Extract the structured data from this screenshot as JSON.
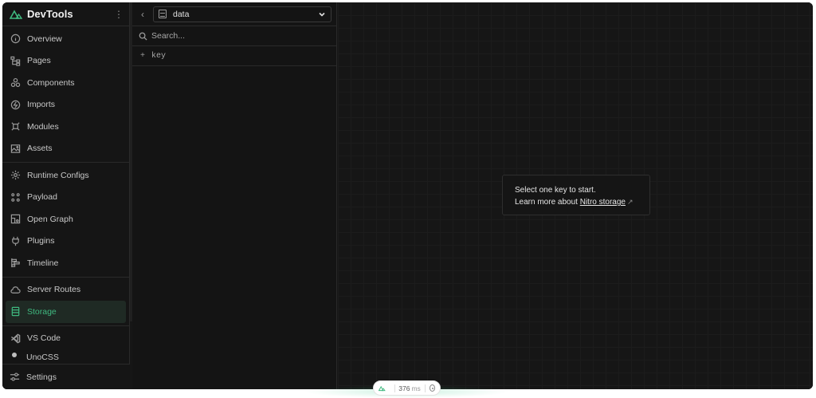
{
  "app": {
    "title": "DevTools",
    "accent": "#3fb87f"
  },
  "sidebar": {
    "groups": [
      [
        {
          "label": "Overview",
          "icon": "info-icon"
        },
        {
          "label": "Pages",
          "icon": "pages-tree-icon"
        },
        {
          "label": "Components",
          "icon": "components-icon"
        },
        {
          "label": "Imports",
          "icon": "imports-icon"
        },
        {
          "label": "Modules",
          "icon": "modules-icon"
        },
        {
          "label": "Assets",
          "icon": "image-icon"
        }
      ],
      [
        {
          "label": "Runtime Configs",
          "icon": "gear-icon"
        },
        {
          "label": "Payload",
          "icon": "payload-icon"
        },
        {
          "label": "Open Graph",
          "icon": "open-graph-icon"
        },
        {
          "label": "Plugins",
          "icon": "plug-icon"
        },
        {
          "label": "Timeline",
          "icon": "timeline-icon"
        }
      ],
      [
        {
          "label": "Server Routes",
          "icon": "cloud-icon"
        },
        {
          "label": "Storage",
          "icon": "storage-icon",
          "active": true
        }
      ],
      [
        {
          "label": "VS Code",
          "icon": "vscode-icon"
        }
      ]
    ],
    "partial_label": "UnoCSS",
    "bottom": {
      "label": "Settings",
      "icon": "settings-sliders-icon"
    }
  },
  "middle": {
    "storage_select": "data",
    "search_placeholder": "Search...",
    "add_key_label": "key"
  },
  "main": {
    "empty_line1": "Select one key to start.",
    "empty_line2_prefix": "Learn more about",
    "empty_link": "Nitro storage",
    "empty_link_icon": "external-link-icon"
  },
  "status": {
    "render_time": "376",
    "unit": "ms"
  }
}
